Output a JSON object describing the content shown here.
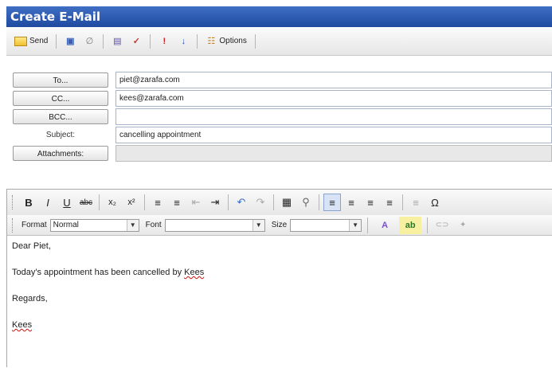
{
  "window": {
    "title": "Create E-Mail"
  },
  "toolbar": {
    "send_label": "Send",
    "options_label": "Options",
    "icons": [
      "envelope-icon",
      "save-icon",
      "attach-icon",
      "print-icon",
      "spellcheck-icon",
      "high-priority-icon",
      "low-priority-icon",
      "options-icon"
    ]
  },
  "header": {
    "to_label": "To...",
    "to_value": "piet@zarafa.com",
    "cc_label": "CC...",
    "cc_value": "kees@zarafa.com",
    "bcc_label": "BCC...",
    "bcc_value": "",
    "subject_label": "Subject:",
    "subject_value": "cancelling appointment",
    "attachments_label": "Attachments:",
    "attachments_value": ""
  },
  "editor": {
    "toolbar1": {
      "bold": "B",
      "italic": "I",
      "underline": "U",
      "strike": "abc",
      "subscript": "x₂",
      "superscript": "x²",
      "ordered_list": "≡",
      "unordered_list": "≡",
      "outdent": "⇤",
      "indent": "⇥",
      "undo": "↶",
      "redo": "↷",
      "table": "▦",
      "link": "⚲",
      "align_left": "≡",
      "align_center": "≡",
      "align_right": "≡",
      "align_justify": "≡",
      "hr": "≡",
      "special_char": "Ω"
    },
    "toolbar2": {
      "format_label": "Format",
      "format_value": "Normal",
      "font_label": "Font",
      "font_value": "",
      "size_label": "Size",
      "size_value": "",
      "text_color": "A",
      "bg_color": "ab"
    },
    "body": {
      "line1": "Dear Piet,",
      "line2_prefix": "Today's appointment has been cancelled by ",
      "line2_name": "Kees",
      "line3": "Regards,",
      "line4": "Kees"
    }
  },
  "colors": {
    "titlebar": "#2a56b0",
    "accent_active": "#d8e4f6",
    "spell_underline": "#d01010"
  }
}
